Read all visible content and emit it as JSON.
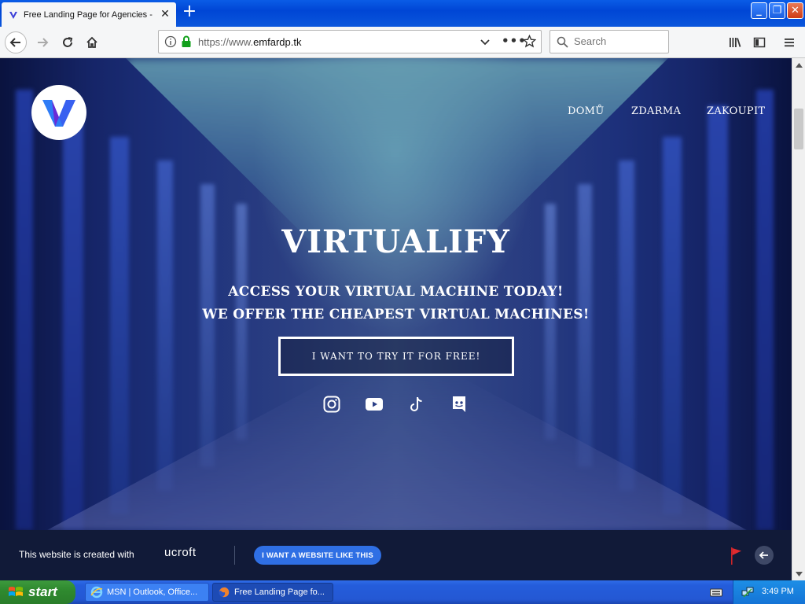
{
  "browser": {
    "tab_title": "Free Landing Page for Agencies - ",
    "new_tab_label": "+",
    "url_scheme": "https://www.",
    "url_host": "emfardp.tk",
    "search_placeholder": "Search"
  },
  "site": {
    "nav": [
      {
        "label": "DOMŮ"
      },
      {
        "label": "ZDARMA"
      },
      {
        "label": "ZAKOUPIT"
      }
    ],
    "hero_title": "VIRTUALIFY",
    "hero_line1": "ACCESS YOUR VIRTUAL MACHINE TODAY!",
    "hero_line2": "WE OFFER THE CHEAPEST VIRTUAL MACHINES!",
    "cta_label": "I WANT TO TRY IT FOR FREE!",
    "social_icons": [
      "instagram-icon",
      "youtube-icon",
      "tiktok-icon",
      "discord-icon"
    ]
  },
  "ucraft": {
    "created_with": "This website is created with",
    "brand": "ucroft",
    "button_label": "I WANT A WEBSITE LIKE THIS"
  },
  "taskbar": {
    "start_label": "start",
    "items": [
      {
        "label": "MSN | Outlook, Office..."
      },
      {
        "label": "Free Landing Page fo..."
      }
    ],
    "clock": "3:49 PM"
  },
  "colors": {
    "xp_blue": "#0046d5",
    "ucraft_button": "#2f6fe4",
    "ucraft_bar": "#111a38",
    "lock_green": "#12a01b",
    "logo_purple": "#6a2bd6",
    "logo_blue": "#2e7cf6"
  }
}
